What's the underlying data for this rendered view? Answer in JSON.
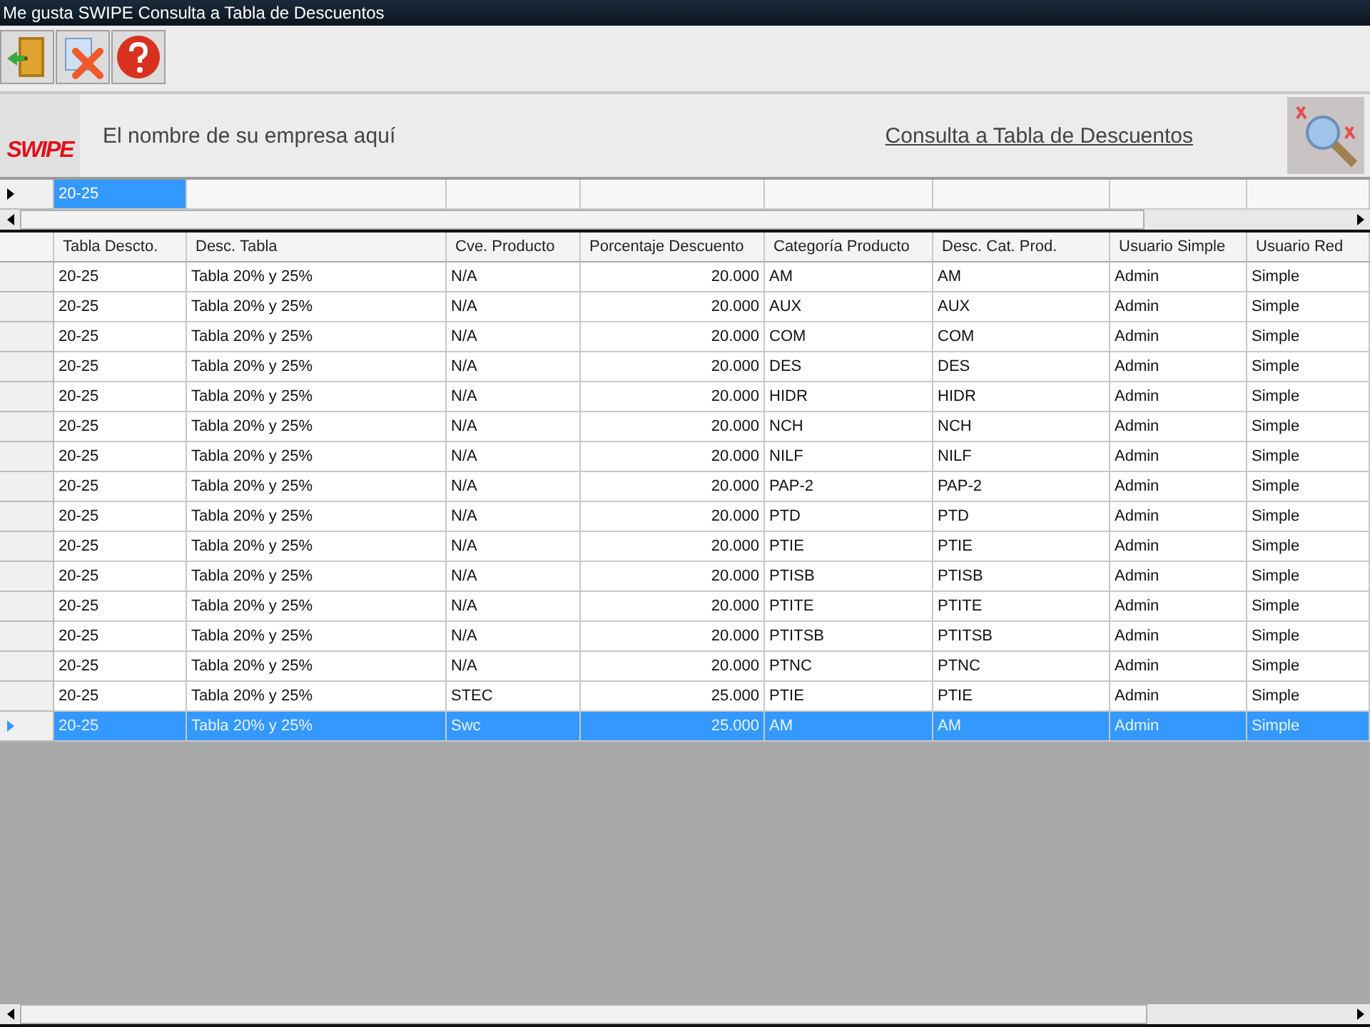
{
  "window": {
    "title": "Me gusta SWIPE Consulta a Tabla de Descuentos"
  },
  "header": {
    "logo": "SWIPE",
    "company": "El nombre de su empresa aquí",
    "link": "Consulta a Tabla de Descuentos"
  },
  "top_grid": {
    "value": "20-25",
    "selected": true
  },
  "table": {
    "columns": [
      "Tabla Descto.",
      "Desc. Tabla",
      "Cve. Producto",
      "Porcentaje Descuento",
      "Categoría Producto",
      "Desc. Cat. Prod.",
      "Usuario Simple",
      "Usuario Red"
    ],
    "rows": [
      {
        "cells": [
          "20-25",
          "Tabla 20% y 25%",
          "N/A",
          "20.000",
          "AM",
          "AM",
          "Admin",
          "Simple"
        ],
        "selected": false
      },
      {
        "cells": [
          "20-25",
          "Tabla 20% y 25%",
          "N/A",
          "20.000",
          "AUX",
          "AUX",
          "Admin",
          "Simple"
        ],
        "selected": false
      },
      {
        "cells": [
          "20-25",
          "Tabla 20% y 25%",
          "N/A",
          "20.000",
          "COM",
          "COM",
          "Admin",
          "Simple"
        ],
        "selected": false
      },
      {
        "cells": [
          "20-25",
          "Tabla 20% y 25%",
          "N/A",
          "20.000",
          "DES",
          "DES",
          "Admin",
          "Simple"
        ],
        "selected": false
      },
      {
        "cells": [
          "20-25",
          "Tabla 20% y 25%",
          "N/A",
          "20.000",
          "HIDR",
          "HIDR",
          "Admin",
          "Simple"
        ],
        "selected": false
      },
      {
        "cells": [
          "20-25",
          "Tabla 20% y 25%",
          "N/A",
          "20.000",
          "NCH",
          "NCH",
          "Admin",
          "Simple"
        ],
        "selected": false
      },
      {
        "cells": [
          "20-25",
          "Tabla 20% y 25%",
          "N/A",
          "20.000",
          "NILF",
          "NILF",
          "Admin",
          "Simple"
        ],
        "selected": false
      },
      {
        "cells": [
          "20-25",
          "Tabla 20% y 25%",
          "N/A",
          "20.000",
          "PAP-2",
          "PAP-2",
          "Admin",
          "Simple"
        ],
        "selected": false
      },
      {
        "cells": [
          "20-25",
          "Tabla 20% y 25%",
          "N/A",
          "20.000",
          "PTD",
          "PTD",
          "Admin",
          "Simple"
        ],
        "selected": false
      },
      {
        "cells": [
          "20-25",
          "Tabla 20% y 25%",
          "N/A",
          "20.000",
          "PTIE",
          "PTIE",
          "Admin",
          "Simple"
        ],
        "selected": false
      },
      {
        "cells": [
          "20-25",
          "Tabla 20% y 25%",
          "N/A",
          "20.000",
          "PTISB",
          "PTISB",
          "Admin",
          "Simple"
        ],
        "selected": false
      },
      {
        "cells": [
          "20-25",
          "Tabla 20% y 25%",
          "N/A",
          "20.000",
          "PTITE",
          "PTITE",
          "Admin",
          "Simple"
        ],
        "selected": false
      },
      {
        "cells": [
          "20-25",
          "Tabla 20% y 25%",
          "N/A",
          "20.000",
          "PTITSB",
          "PTITSB",
          "Admin",
          "Simple"
        ],
        "selected": false
      },
      {
        "cells": [
          "20-25",
          "Tabla 20% y 25%",
          "N/A",
          "20.000",
          "PTNC",
          "PTNC",
          "Admin",
          "Simple"
        ],
        "selected": false
      },
      {
        "cells": [
          "20-25",
          "Tabla 20% y 25%",
          "STEC",
          "25.000",
          "PTIE",
          "PTIE",
          "Admin",
          "Simple"
        ],
        "selected": false
      },
      {
        "cells": [
          "20-25",
          "Tabla 20% y 25%",
          "Swc",
          "25.000",
          "AM",
          "AM",
          "Admin",
          "Simple"
        ],
        "selected": true
      }
    ]
  }
}
